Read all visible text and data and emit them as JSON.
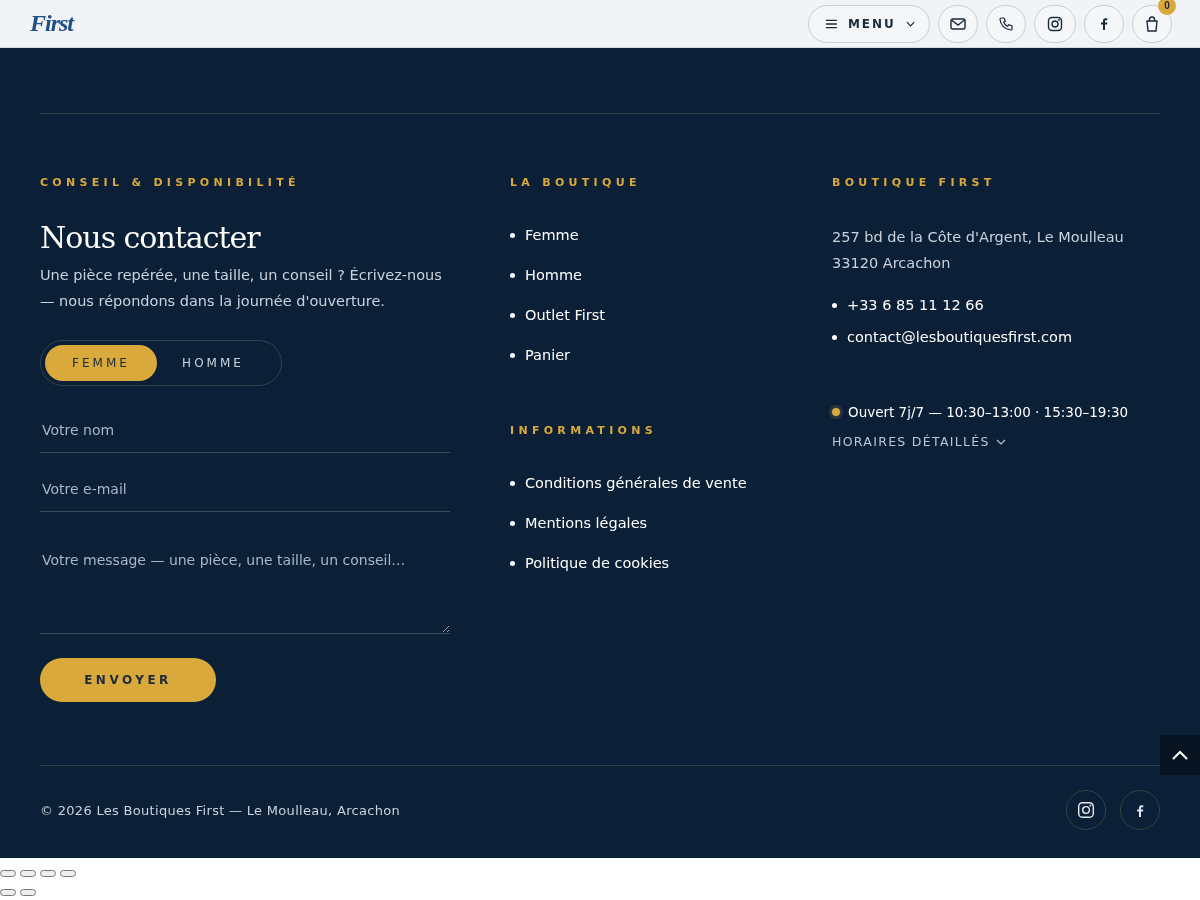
{
  "header": {
    "logo": "First",
    "menu_label": "MENU",
    "cart_count": "0",
    "icons": [
      {
        "kind": "mail"
      },
      {
        "kind": "phone"
      },
      {
        "kind": "instagram"
      },
      {
        "kind": "facebook"
      }
    ]
  },
  "contact": {
    "eyebrow": "CONSEIL & DISPONIBILITÉ",
    "title": "Nous contacter",
    "intro": "Une pièce repérée, une taille, un conseil ? Écrivez-nous — nous répondons dans la journée d'ouverture.",
    "toggle": [
      {
        "label": "FEMME",
        "selected": true
      },
      {
        "label": "HOMME",
        "selected": false
      }
    ],
    "fields": [
      {
        "kind": "input",
        "placeholder": "Votre nom"
      },
      {
        "kind": "input",
        "placeholder": "Votre e-mail"
      },
      {
        "kind": "textarea",
        "placeholder": "Votre message — une pièce, une taille, un conseil…"
      }
    ],
    "submit": "ENVOYER"
  },
  "shop": {
    "heading": "LA BOUTIQUE",
    "links": [
      "Femme",
      "Homme",
      "Outlet First",
      "Panier"
    ]
  },
  "info": {
    "heading": "INFORMATIONS",
    "links": [
      "Conditions générales de vente",
      "Mentions légales",
      "Politique de cookies"
    ]
  },
  "store": {
    "heading": "BOUTIQUE FIRST",
    "address": [
      "257 bd de la Côte d'Argent, Le Moulleau",
      "33120 Arcachon"
    ],
    "contacts": [
      "+33 6 85 11 12 66",
      "contact@lesboutiquesfirst.com"
    ],
    "open": true,
    "hours": "Ouvert 7j/7 — 10:30–13:00 · 15:30–19:30",
    "details": "HORAIRES DÉTAILLÉS"
  },
  "bottom": {
    "copyright": "© 2026 Les Boutiques First — Le Moulleau, Arcachon",
    "social": [
      {
        "kind": "instagram"
      },
      {
        "kind": "facebook"
      }
    ]
  }
}
